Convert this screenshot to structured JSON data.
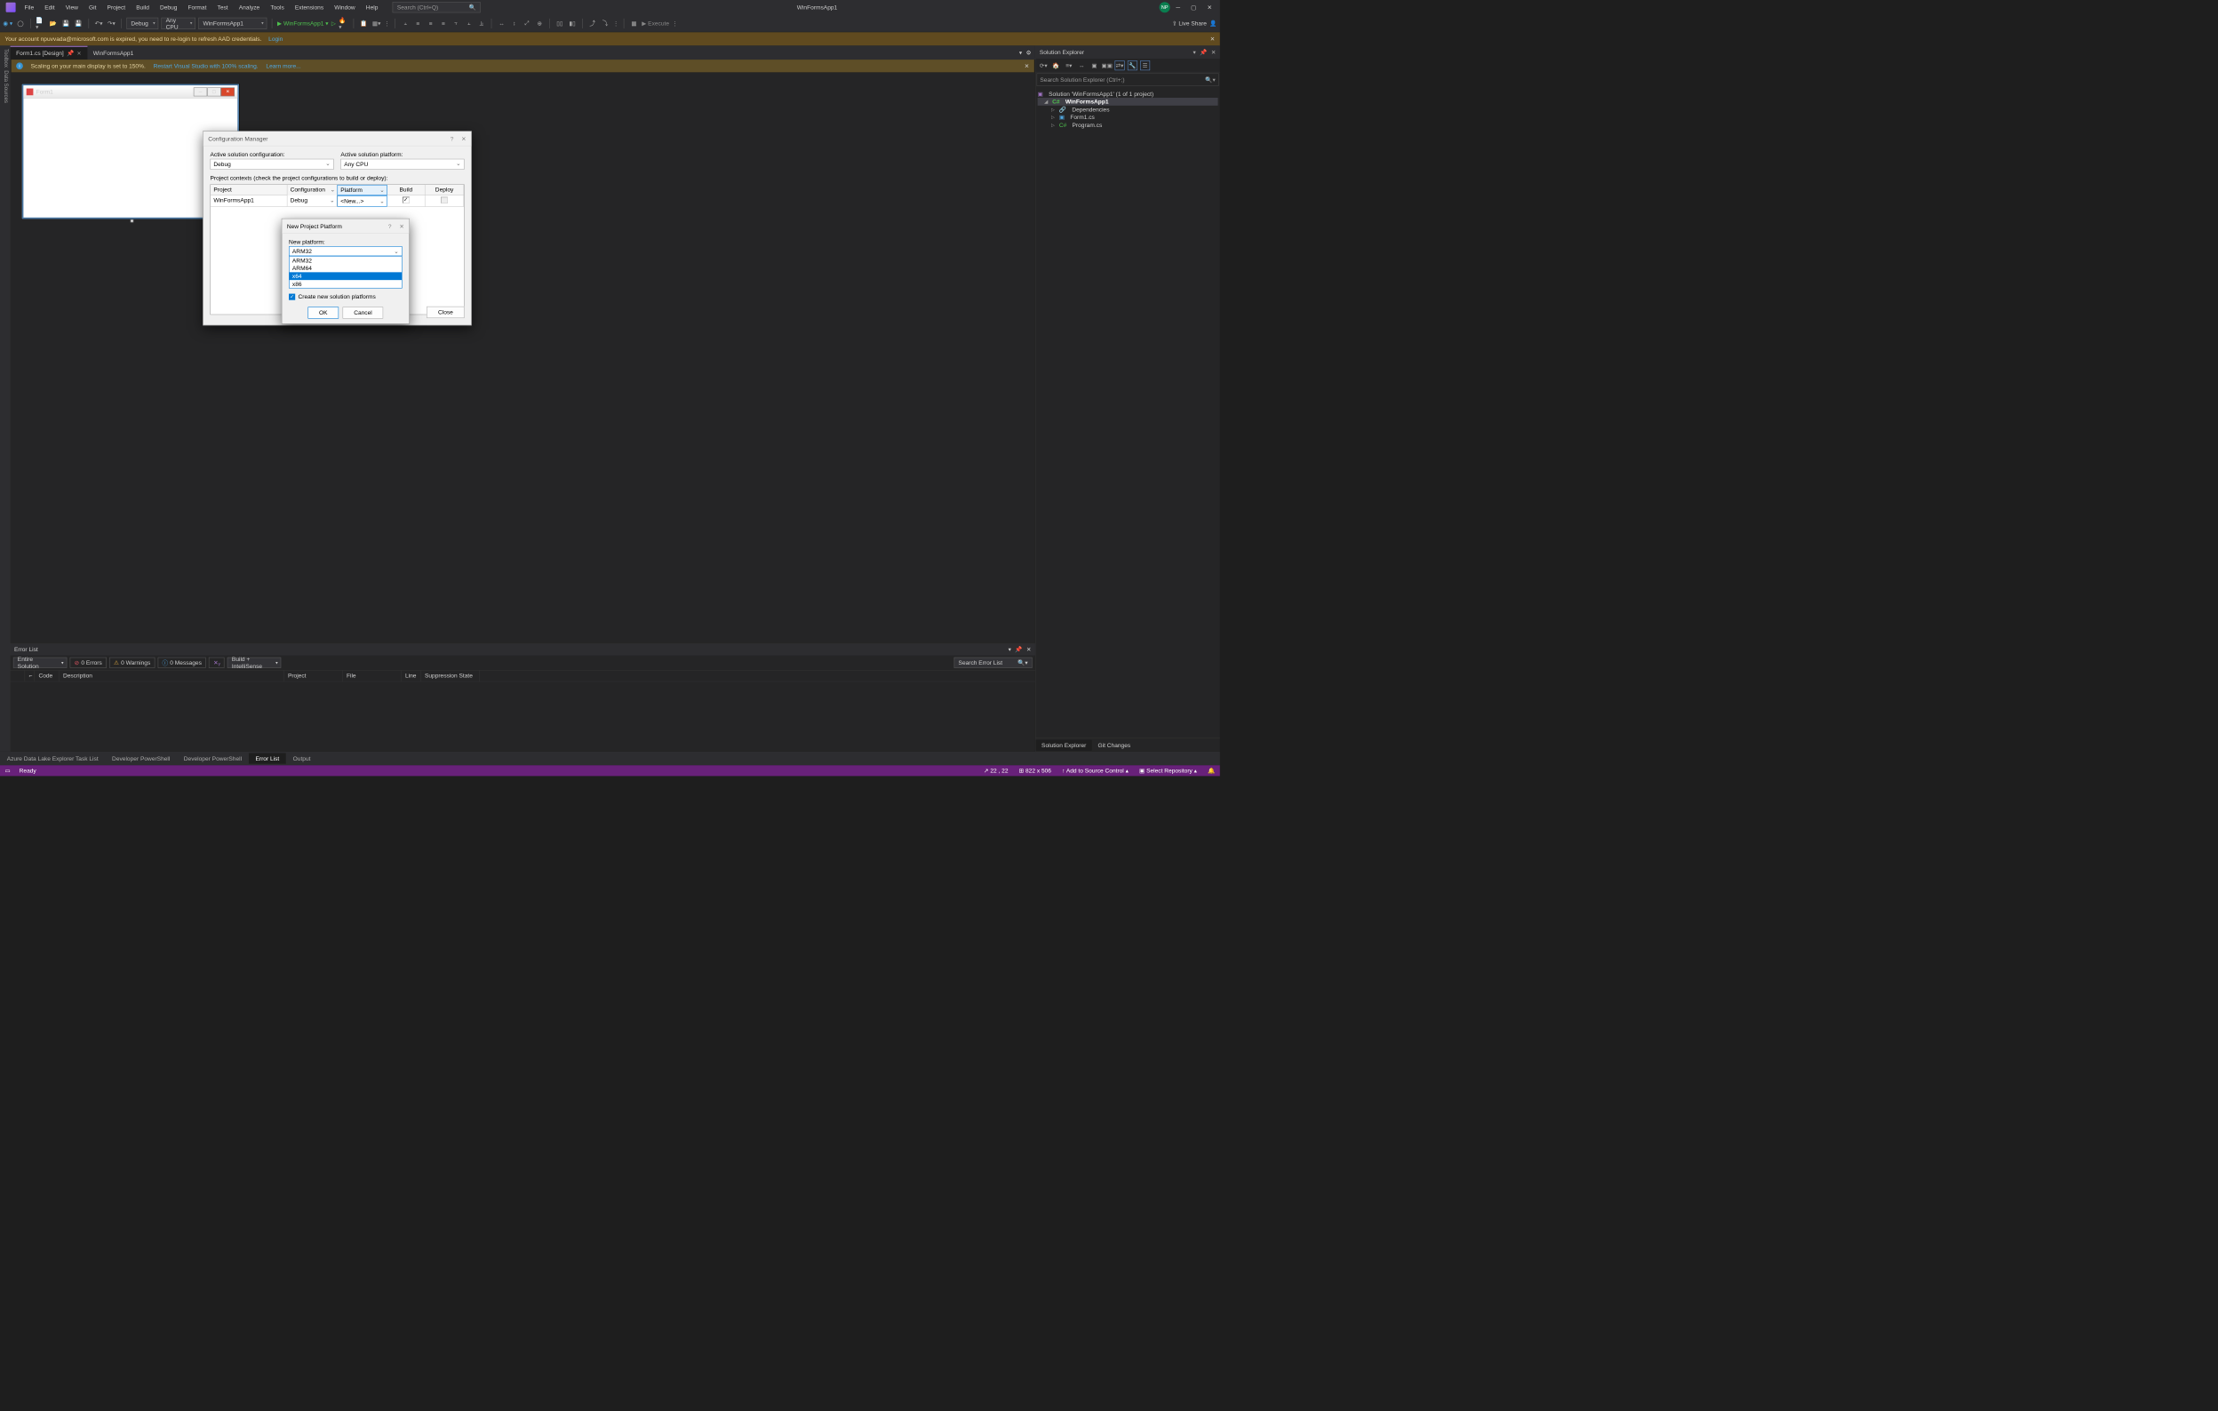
{
  "title": "WinFormsApp1",
  "menu": [
    "File",
    "Edit",
    "View",
    "Git",
    "Project",
    "Build",
    "Debug",
    "Format",
    "Test",
    "Analyze",
    "Tools",
    "Extensions",
    "Window",
    "Help"
  ],
  "searchPlaceholder": "Search (Ctrl+Q)",
  "userInitials": "NP",
  "toolbar": {
    "config": "Debug",
    "platform": "Any CPU",
    "startup": "WinFormsApp1",
    "startBtn": "WinFormsApp1",
    "execute": "Execute",
    "liveShare": "Live Share"
  },
  "banner": {
    "msg": "Your account npuvvada@microsoft.com is expired, you need to re-login to refresh AAD credentials.",
    "login": "Login"
  },
  "tabs": [
    {
      "label": "Form1.cs [Design]",
      "active": true,
      "pinned": true
    },
    {
      "label": "WinFormsApp1",
      "active": false
    }
  ],
  "scaling": {
    "info": "ⓘ",
    "msg": "Scaling on your main display is set to 150%.",
    "link1": "Restart Visual Studio with 100% scaling.",
    "link2": "Learn more..."
  },
  "form": {
    "title": "Form1"
  },
  "cfgMgr": {
    "title": "Configuration Manager",
    "activeCfgLbl": "Active solution configuration:",
    "activeCfg": "Debug",
    "activePlatLbl": "Active solution platform:",
    "activePlat": "Any CPU",
    "contextsLbl": "Project contexts (check the project configurations to build or deploy):",
    "cols": [
      "Project",
      "Configuration",
      "Platform",
      "Build",
      "Deploy"
    ],
    "row": {
      "project": "WinFormsApp1",
      "config": "Debug",
      "platform": "<New...>"
    },
    "close": "Close"
  },
  "newPlat": {
    "title": "New Project Platform",
    "lbl": "New platform:",
    "selected": "ARM32",
    "options": [
      "ARM32",
      "ARM64",
      "x64",
      "x86"
    ],
    "highlighted": "x64",
    "chk": "Create new solution platforms",
    "ok": "OK",
    "cancel": "Cancel"
  },
  "solExp": {
    "title": "Solution Explorer",
    "search": "Search Solution Explorer (Ctrl+;)",
    "solution": "Solution 'WinFormsApp1' (1 of 1 project)",
    "project": "WinFormsApp1",
    "deps": "Dependencies",
    "form": "Form1.cs",
    "program": "Program.cs",
    "tabs": [
      "Solution Explorer",
      "Git Changes"
    ]
  },
  "errList": {
    "title": "Error List",
    "scope": "Entire Solution",
    "errors": "0 Errors",
    "warnings": "0 Warnings",
    "messages": "0 Messages",
    "buildFilter": "Build + IntelliSense",
    "search": "Search Error List",
    "cols": [
      "",
      "Code",
      "Description",
      "Project",
      "File",
      "Line",
      "Suppression State"
    ]
  },
  "bottomTabs": [
    "Azure Data Lake Explorer Task List",
    "Developer PowerShell",
    "Developer PowerShell",
    "Error List",
    "Output"
  ],
  "status": {
    "ready": "Ready",
    "pos": "22 , 22",
    "size": "822 x 506",
    "addSrc": "Add to Source Control",
    "repo": "Select Repository"
  }
}
